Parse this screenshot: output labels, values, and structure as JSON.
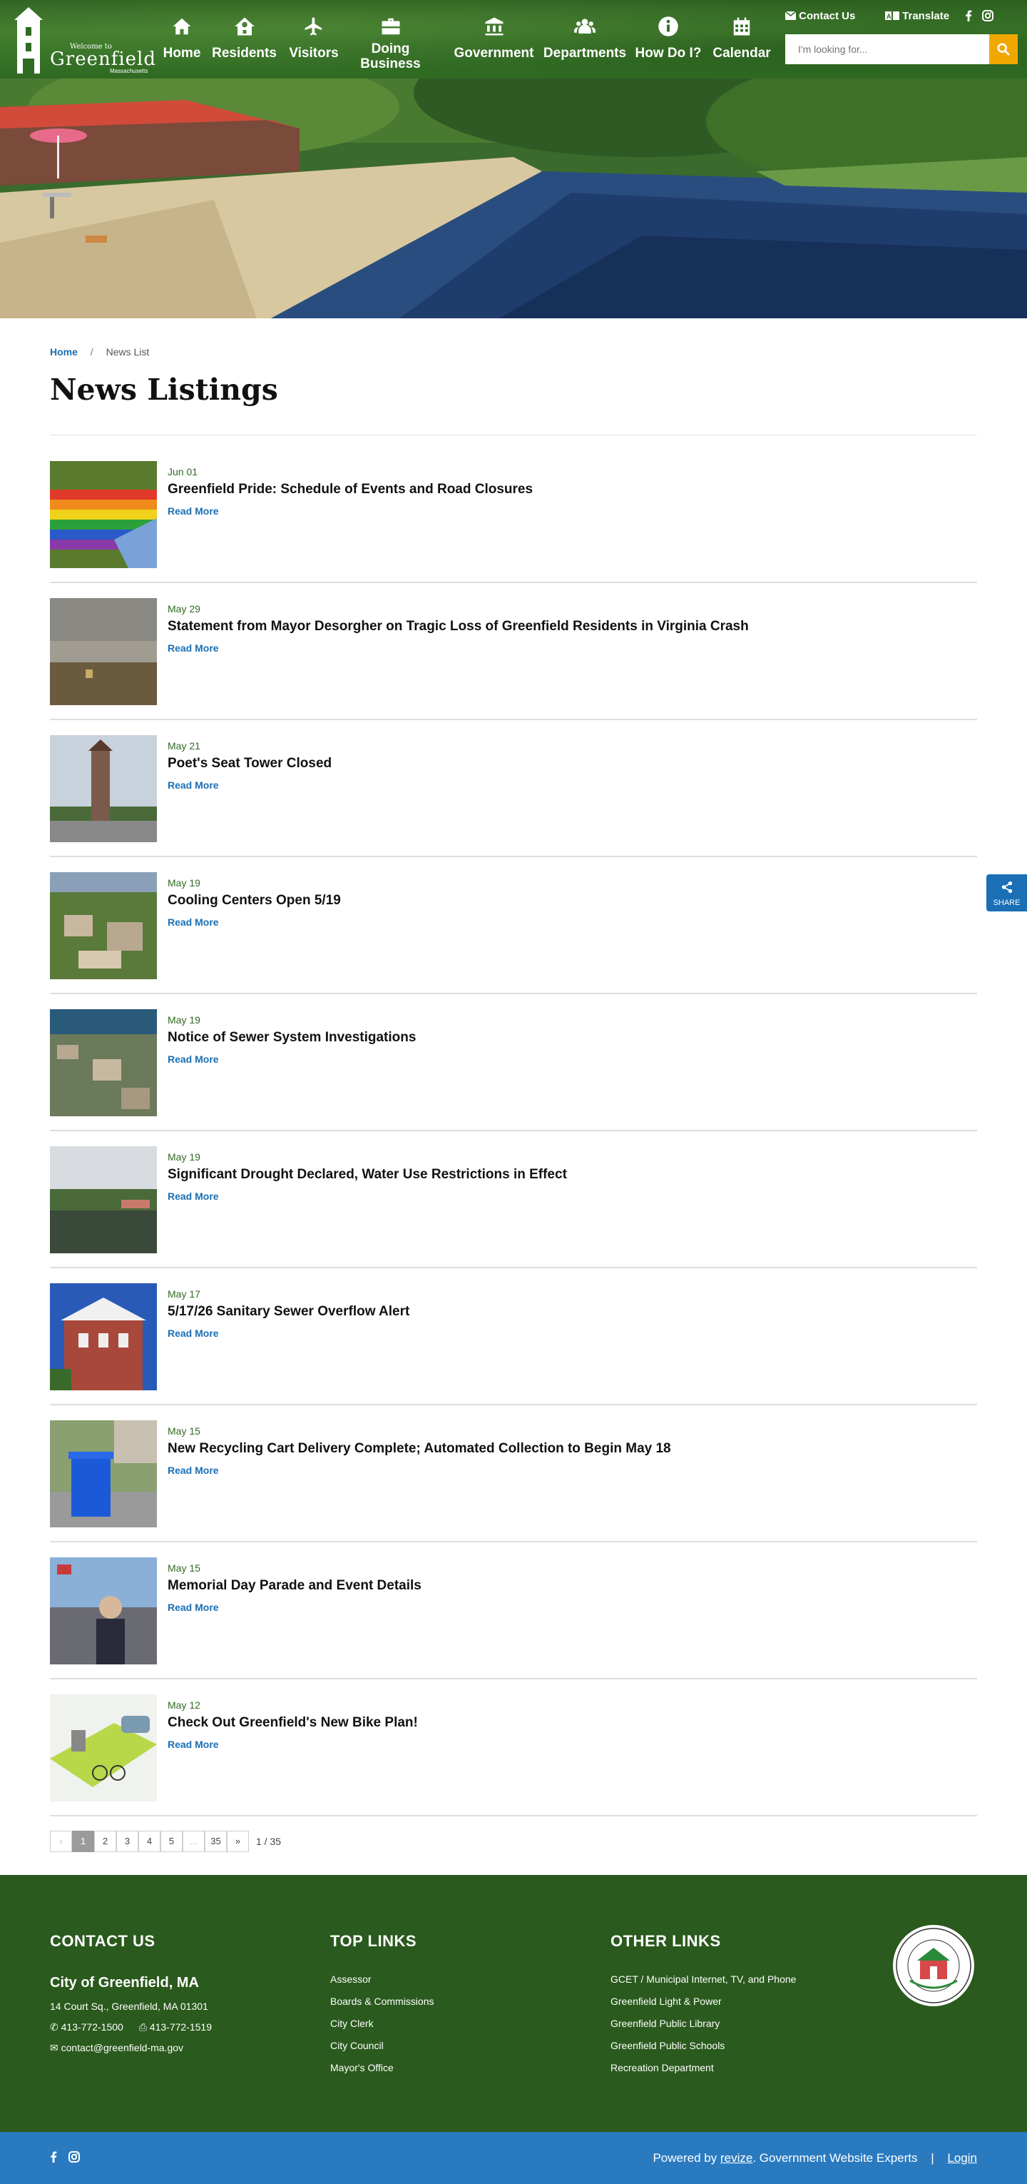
{
  "header": {
    "logo": {
      "welcome": "Welcome to",
      "city": "Greenfield",
      "state": "Massachusetts"
    },
    "nav": [
      {
        "label": "Home",
        "icon": "home-icon"
      },
      {
        "label": "Residents",
        "icon": "house-icon"
      },
      {
        "label": "Visitors",
        "icon": "plane-icon"
      },
      {
        "label": "Doing Business",
        "icon": "briefcase-icon"
      },
      {
        "label": "Government",
        "icon": "bank-icon"
      },
      {
        "label": "Departments",
        "icon": "users-icon"
      },
      {
        "label": "How Do I?",
        "icon": "info-icon"
      },
      {
        "label": "Calendar",
        "icon": "calendar-icon"
      }
    ],
    "contact_label": "Contact Us",
    "translate_label": "Translate",
    "search_placeholder": "I'm looking for..."
  },
  "breadcrumb": {
    "home": "Home",
    "separator": "/",
    "current": "News List"
  },
  "page_title": "News Listings",
  "news": [
    {
      "date": "Jun 01",
      "title": "Greenfield Pride: Schedule of Events and Road Closures",
      "more": "Read More"
    },
    {
      "date": "May 29",
      "title": "Statement from Mayor Desorgher on Tragic Loss of Greenfield Residents in Virginia Crash",
      "more": "Read More"
    },
    {
      "date": "May 21",
      "title": "Poet's Seat Tower Closed",
      "more": "Read More"
    },
    {
      "date": "May 19",
      "title": "Cooling Centers Open 5/19",
      "more": "Read More"
    },
    {
      "date": "May 19",
      "title": "Notice of Sewer System Investigations",
      "more": "Read More"
    },
    {
      "date": "May 19",
      "title": "Significant Drought Declared, Water Use Restrictions in Effect",
      "more": "Read More"
    },
    {
      "date": "May 17",
      "title": "5/17/26 Sanitary Sewer Overflow Alert",
      "more": "Read More"
    },
    {
      "date": "May 15",
      "title": "New Recycling Cart Delivery Complete; Automated Collection to Begin May 18",
      "more": "Read More"
    },
    {
      "date": "May 15",
      "title": "Memorial Day Parade and Event Details",
      "more": "Read More"
    },
    {
      "date": "May 12",
      "title": "Check Out Greenfield's New Bike Plan!",
      "more": "Read More"
    }
  ],
  "pagination": {
    "pages": [
      "‹",
      "1",
      "2",
      "3",
      "4",
      "5",
      "...",
      "35",
      "»"
    ],
    "current": "1",
    "count": "1 / 35"
  },
  "share_label": "SHARE",
  "footer": {
    "contact": {
      "heading": "CONTACT US",
      "org": "City of Greenfield, MA",
      "address": "14 Court Sq., Greenfield, MA 01301",
      "phone": "413-772-1500",
      "fax": "413-772-1519",
      "email": "contact@greenfield-ma.gov"
    },
    "top_links": {
      "heading": "TOP LINKS",
      "items": [
        "Assessor",
        "Boards & Commissions",
        "City Clerk",
        "City Council",
        "Mayor's Office"
      ]
    },
    "other_links": {
      "heading": "OTHER LINKS",
      "items": [
        "GCET / Municipal Internet, TV, and Phone",
        "Greenfield Light & Power",
        "Greenfield Public Library",
        "Greenfield Public Schools",
        "Recreation Department"
      ]
    },
    "seal_text": "GREENFIELD MASSACHUSETTS"
  },
  "bottom_bar": {
    "powered_prefix": "Powered by",
    "powered_brand": "revize",
    "powered_suffix": ". Government Website Experts",
    "divider": "|",
    "login": "Login"
  },
  "colors": {
    "header_green": "#2f6a22",
    "footer_green": "#2a5a1d",
    "link_blue": "#1a6fb5",
    "accent_gold": "#f0a800",
    "bottom_blue": "#2a7ac0"
  }
}
